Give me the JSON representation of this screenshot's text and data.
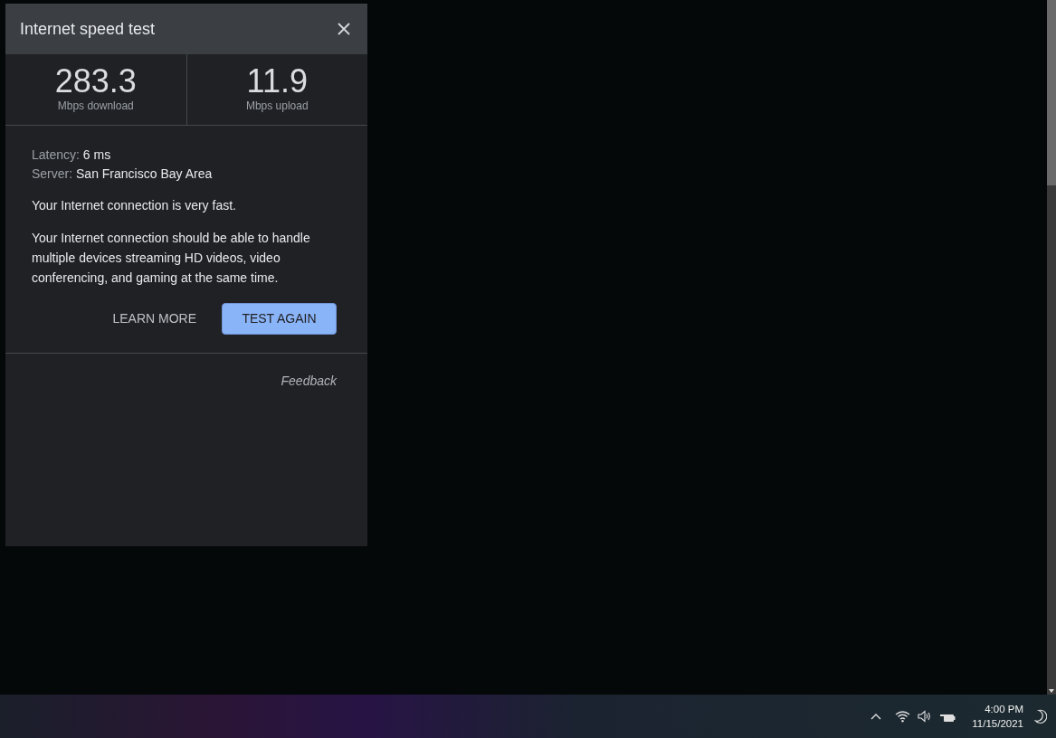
{
  "dialog": {
    "title": "Internet speed test",
    "results": [
      {
        "value": "283.3",
        "label": "Mbps download"
      },
      {
        "value": "11.9",
        "label": "Mbps upload"
      }
    ],
    "details": [
      {
        "label": "Latency:",
        "value": "6 ms"
      },
      {
        "label": "Server:",
        "value": "San Francisco Bay Area"
      }
    ],
    "summary": "Your Internet connection is very fast.",
    "description": "Your Internet connection should be able to handle multiple devices streaming HD videos, video conferencing, and gaming at the same time.",
    "buttons": [
      {
        "label": "LEARN MORE",
        "kind": "text"
      },
      {
        "label": "TEST AGAIN",
        "kind": "primary"
      }
    ],
    "feedback": "Feedback"
  },
  "taskbar": {
    "time": "4:00 PM",
    "date": "11/15/2021"
  }
}
